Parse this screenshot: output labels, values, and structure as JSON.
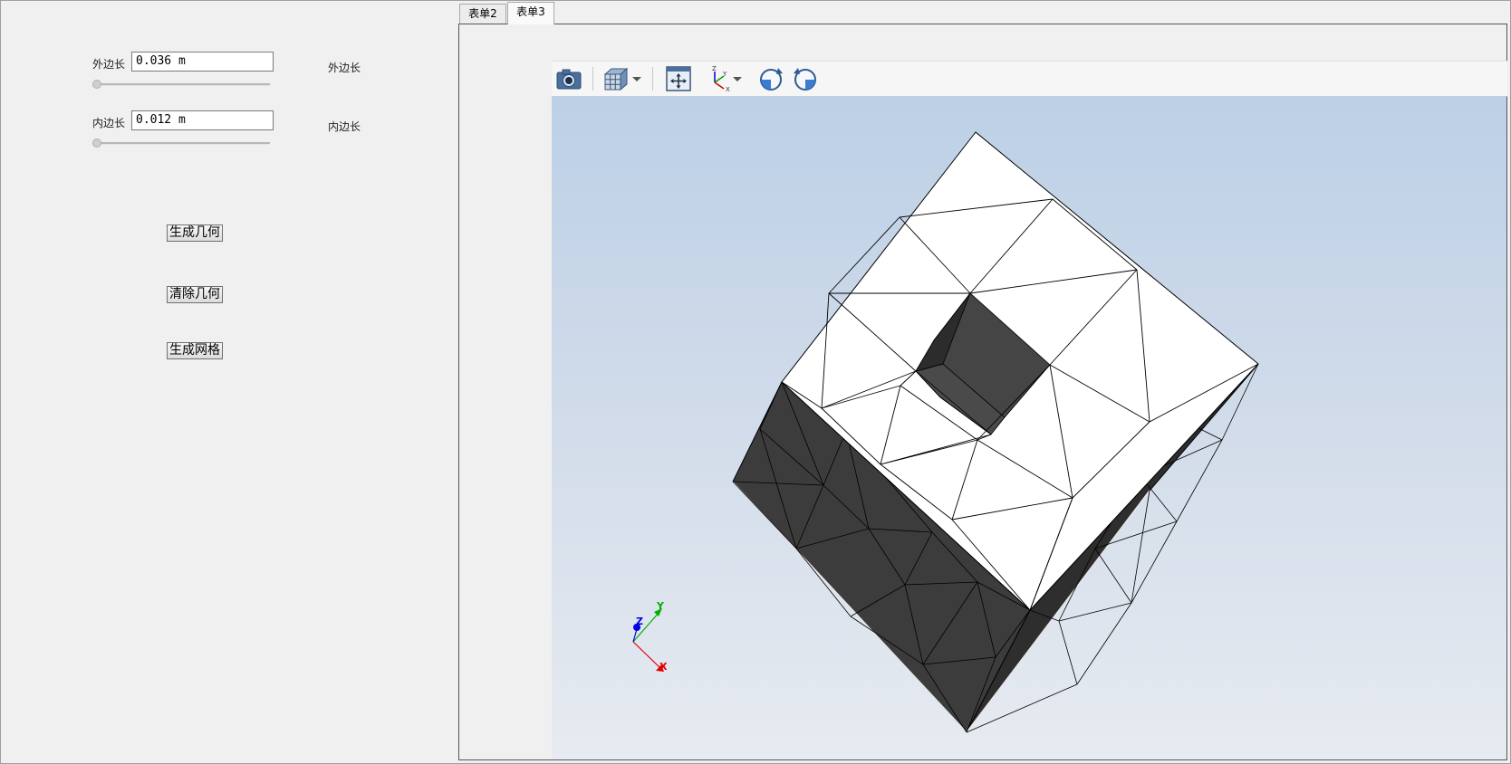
{
  "left_panel": {
    "outer": {
      "label": "外边长",
      "value": "0.036 m",
      "side_label": "外边长",
      "slider_position": 0
    },
    "inner": {
      "label": "内边长",
      "value": "0.012 m",
      "side_label": "内边长",
      "slider_position": 0
    },
    "buttons": {
      "generate_geometry": "生成几何",
      "clear_geometry": "清除几何",
      "generate_mesh": "生成网格"
    }
  },
  "tabs": [
    {
      "label": "表单2",
      "active": false
    },
    {
      "label": "表单3",
      "active": true
    }
  ],
  "toolbar": {
    "icons": [
      "camera-icon",
      "cube-view-icon",
      "dropdown-arrow-icon",
      "fit-all-icon",
      "axes-orientation-icon",
      "dropdown-arrow-icon",
      "rotate-clockwise-icon",
      "rotate-counterclockwise-icon"
    ]
  },
  "axis_triad": {
    "x": "X",
    "y": "Y",
    "z": "Z"
  },
  "colors": {
    "x_axis": "#e00000",
    "y_axis": "#00b000",
    "z_axis": "#0000e0",
    "face_light": "#ffffff",
    "face_dark": "#3d3d3d"
  }
}
